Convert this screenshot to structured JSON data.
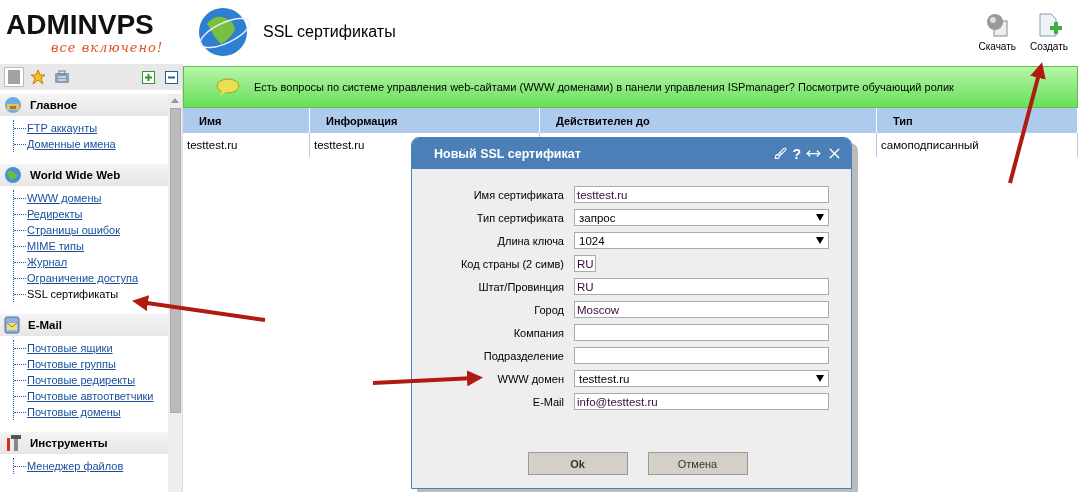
{
  "logo": {
    "name": "ADMINVPS",
    "tagline": "все включено!"
  },
  "page": {
    "title": "SSL сертификаты"
  },
  "toolbar": [
    {
      "label": "Скачать",
      "kind": "download"
    },
    {
      "label": "Создать",
      "kind": "create"
    }
  ],
  "sidebar": {
    "tabs": [
      {
        "kind": "list",
        "selected": true
      },
      {
        "kind": "star",
        "selected": false
      },
      {
        "kind": "case",
        "selected": false
      }
    ],
    "sections": [
      {
        "title": "Главное",
        "kind": "home",
        "items": [
          {
            "label": "FTP аккаунты",
            "selected": false
          },
          {
            "label": "Доменные имена",
            "selected": false
          }
        ]
      },
      {
        "title": "World Wide Web",
        "kind": "web",
        "items": [
          {
            "label": "WWW домены",
            "selected": false
          },
          {
            "label": "Редиректы",
            "selected": false
          },
          {
            "label": "Страницы ошибок",
            "selected": false
          },
          {
            "label": "MIME типы",
            "selected": false
          },
          {
            "label": "Журнал",
            "selected": false
          },
          {
            "label": "Ограничение доступа",
            "selected": false
          },
          {
            "label": "SSL сертификаты",
            "selected": true
          }
        ]
      },
      {
        "title": "E-Mail",
        "kind": "mail",
        "items": [
          {
            "label": "Почтовые ящики",
            "selected": false
          },
          {
            "label": "Почтовые группы",
            "selected": false
          },
          {
            "label": "Почтовые редиректы",
            "selected": false
          },
          {
            "label": "Почтовые автоответчики",
            "selected": false
          },
          {
            "label": "Почтовые домены",
            "selected": false
          }
        ]
      },
      {
        "title": "Инструменты",
        "kind": "tools",
        "items": [
          {
            "label": "Менеджер файлов",
            "selected": false
          }
        ]
      }
    ]
  },
  "banner": {
    "text": "Есть вопросы по системе управления web-сайтами (WWW доменами) в панели управления ISPmanager? Посмотрите обучающий ролик"
  },
  "table": {
    "columns": [
      "Имя",
      "Информация",
      "Действителен до",
      "Тип"
    ],
    "rows": [
      [
        "testtest.ru",
        "testtest.ru",
        "",
        "самоподписанный"
      ]
    ]
  },
  "dialog": {
    "title": "Новый SSL сертификат",
    "help": "?",
    "fields": [
      {
        "label": "Имя сертификата",
        "kind": "text",
        "value": "testtest.ru"
      },
      {
        "label": "Тип сертификата",
        "kind": "select",
        "value": "запрос"
      },
      {
        "label": "Длина ключа",
        "kind": "select",
        "value": "1024"
      },
      {
        "label": "Код страны (2 симв)",
        "kind": "short",
        "value": "RU"
      },
      {
        "label": "Штат/Провинция",
        "kind": "text",
        "value": "RU"
      },
      {
        "label": "Город",
        "kind": "text",
        "value": "Moscow"
      },
      {
        "label": "Компания",
        "kind": "text"
      },
      {
        "label": "Подразделение",
        "kind": "text"
      },
      {
        "label": "WWW домен",
        "kind": "select",
        "value": "testtest.ru"
      },
      {
        "label": "E-Mail",
        "kind": "text",
        "value": "info@testtest.ru"
      }
    ],
    "buttons": [
      {
        "label": "Ok",
        "kind": "ok"
      },
      {
        "label": "Отмена",
        "kind": "cancel"
      }
    ]
  }
}
